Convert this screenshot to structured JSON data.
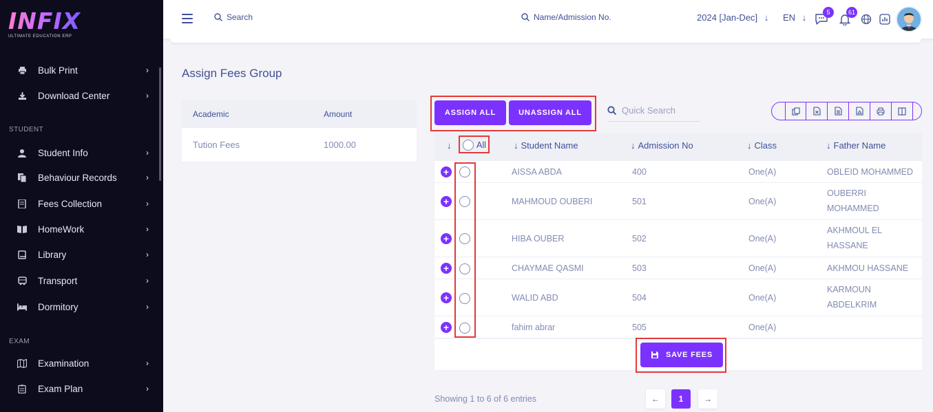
{
  "brand": {
    "logo": "INFIX",
    "tagline": "ULTIMATE EDUCATION ERP"
  },
  "sidebar": {
    "items": [
      {
        "label": "Bulk Print",
        "icon": "printer-icon"
      },
      {
        "label": "Download Center",
        "icon": "download-icon"
      },
      {
        "label": "Student Info",
        "icon": "user-icon"
      },
      {
        "label": "Behaviour Records",
        "icon": "records-icon"
      },
      {
        "label": "Fees Collection",
        "icon": "fees-icon"
      },
      {
        "label": "HomeWork",
        "icon": "book-icon"
      },
      {
        "label": "Library",
        "icon": "library-icon"
      },
      {
        "label": "Transport",
        "icon": "bus-icon"
      },
      {
        "label": "Dormitory",
        "icon": "bed-icon"
      },
      {
        "label": "Examination",
        "icon": "map-icon"
      },
      {
        "label": "Exam Plan",
        "icon": "clipboard-icon"
      }
    ],
    "sections": {
      "student": "STUDENT",
      "exam": "EXAM"
    }
  },
  "header": {
    "search_label": "Search",
    "search2_label": "Name/Admission No.",
    "year": "2024 [Jan-Dec]",
    "lang": "EN",
    "messages_count": "5",
    "notifications_count": "61"
  },
  "page": {
    "title": "Assign Fees Group",
    "fees_table": {
      "headers": [
        "Academic",
        "Amount"
      ],
      "rows": [
        {
          "name": "Tution Fees",
          "amount": "1000.00"
        }
      ]
    },
    "assign_all": "ASSIGN ALL",
    "unassign_all": "UNASSIGN ALL",
    "quick_search_placeholder": "Quick Search",
    "all_label": "All",
    "student_table": {
      "headers": [
        "Student Name",
        "Admission No",
        "Class",
        "Father Name"
      ],
      "rows": [
        {
          "name": "AISSA ABDA",
          "admission": "400",
          "class": "One(A)",
          "father_l1": "OBLEID MOHAMMED",
          "father_l2": ""
        },
        {
          "name": "MAHMOUD OUBERI",
          "admission": "501",
          "class": "One(A)",
          "father_l1": "OUBERRI",
          "father_l2": "MOHAMMED"
        },
        {
          "name": "HIBA OUBER",
          "admission": "502",
          "class": "One(A)",
          "father_l1": "AKHMOUL EL",
          "father_l2": "HASSANE"
        },
        {
          "name": "CHAYMAE QASMI",
          "admission": "503",
          "class": "One(A)",
          "father_l1": "AKHMOU HASSANE",
          "father_l2": ""
        },
        {
          "name": "WALID ABD",
          "admission": "504",
          "class": "One(A)",
          "father_l1": "KARMOUN",
          "father_l2": "ABDELKRIM"
        },
        {
          "name": "fahim abrar",
          "admission": "505",
          "class": "One(A)",
          "father_l1": "",
          "father_l2": ""
        }
      ]
    },
    "save_fees": "SAVE FEES",
    "showing": "Showing 1 to 6 of 6 entries",
    "current_page": "1"
  }
}
